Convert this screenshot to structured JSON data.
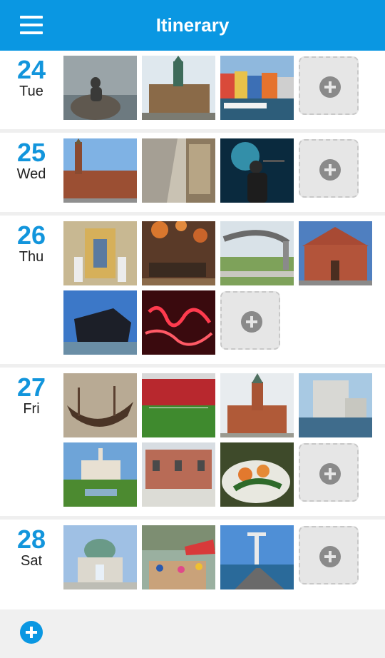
{
  "app": {
    "title": "Itinerary"
  },
  "days": [
    {
      "num": "24",
      "name": "Tue",
      "photos": [
        "little-mermaid-statue",
        "copenhagen-stock-exchange",
        "nyhavn-harbor"
      ]
    },
    {
      "num": "25",
      "name": "Wed",
      "photos": [
        "city-hall",
        "museum-interior",
        "concert-singer"
      ]
    },
    {
      "num": "26",
      "name": "Thu",
      "photos": [
        "church-altar",
        "lounge-interior",
        "park-sculpture",
        "red-brick-building",
        "black-diamond-library",
        "neon-sign"
      ]
    },
    {
      "num": "27",
      "name": "Fri",
      "photos": [
        "viking-ship-museum",
        "football-stadium",
        "church-tower",
        "modern-waterfront-building",
        "tivoli-gardens",
        "brick-museum-building",
        "food-plate"
      ]
    },
    {
      "num": "28",
      "name": "Sat",
      "photos": [
        "marble-church",
        "street-market",
        "bellevue-lifeguard-tower"
      ]
    }
  ],
  "icons": {
    "menu": "hamburger-menu-icon",
    "add": "plus-circle-icon"
  },
  "colors": {
    "primary": "#0a97e2",
    "day_number": "#1295dc"
  }
}
